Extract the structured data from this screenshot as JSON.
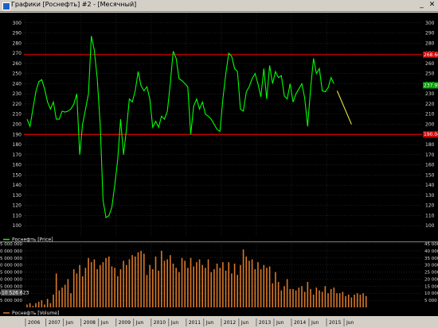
{
  "window": {
    "title": "Графики [Роснефть] #2 - [Месячный]",
    "minimize_glyph": "_",
    "close_glyph": "✕"
  },
  "colors": {
    "background": "#000000",
    "grid": "#3a3a3a",
    "price_line": "#00ff00",
    "projection_line": "#e8e040",
    "level_line": "#e00000",
    "level_badge": "#cc0000",
    "volume_bar": "#d87828",
    "current_price_badge": "#00a000"
  },
  "chart_data": [
    {
      "type": "line",
      "legend": "Роснефть [Price]",
      "ylim": [
        90,
        310
      ],
      "yticks": [
        100,
        110,
        120,
        130,
        140,
        150,
        160,
        170,
        180,
        190,
        200,
        210,
        220,
        230,
        240,
        250,
        260,
        270,
        280,
        290,
        300
      ],
      "grid": true,
      "levels": [
        {
          "value": 268.66,
          "label": "268.66"
        },
        {
          "value": 190.04,
          "label": "190.04"
        }
      ],
      "current_price_label": "237.95",
      "series": [
        {
          "values": [
            205,
            198,
            215,
            232,
            242,
            244,
            235,
            222,
            215,
            222,
            205,
            205,
            213,
            212,
            213,
            215,
            220,
            230,
            170,
            200,
            215,
            230,
            287,
            273,
            245,
            200,
            125,
            108,
            110,
            118,
            140,
            165,
            205,
            170,
            195,
            225,
            222,
            233,
            252,
            238,
            233,
            237,
            225,
            197,
            203,
            197,
            208,
            205,
            213,
            240,
            272,
            265,
            245,
            243,
            240,
            237,
            190,
            218,
            225,
            215,
            222,
            210,
            208,
            205,
            200,
            195,
            193,
            225,
            250,
            270,
            267,
            255,
            252,
            215,
            213,
            232,
            237,
            245,
            250,
            240,
            227,
            255,
            225,
            258,
            240,
            252,
            246,
            248,
            228,
            225,
            240,
            222,
            230,
            235,
            240,
            226,
            198,
            235,
            265,
            250,
            255,
            233,
            232,
            236,
            246,
            240
          ]
        },
        {
          "name": "projection",
          "values": [
            233,
            200
          ]
        }
      ]
    },
    {
      "type": "bar",
      "legend": "Роснефть [Volume]",
      "ylim": [
        0,
        45000000
      ],
      "yticks": [
        "5 000 000",
        "10 000 000",
        "15 000 000",
        "20 000 000",
        "25 000 000",
        "30 000 000",
        "35 000 000",
        "40 000 000",
        "45 000 000"
      ],
      "current_value_label": "10 526 623",
      "grid": true,
      "values": [
        2,
        3,
        1,
        3,
        4,
        5,
        2,
        6,
        3,
        9,
        24,
        12,
        14,
        16,
        20,
        10,
        27,
        24,
        30,
        22,
        28,
        35,
        32,
        34,
        27,
        30,
        32,
        35,
        36,
        29,
        28,
        22,
        27,
        33,
        30,
        34,
        37,
        36,
        39,
        40,
        38,
        23,
        30,
        27,
        36,
        26,
        40,
        33,
        34,
        37,
        31,
        28,
        25,
        35,
        33,
        28,
        35,
        29,
        32,
        34,
        30,
        28,
        34,
        25,
        27,
        31,
        28,
        32,
        26,
        32,
        24,
        31,
        23,
        30,
        41,
        36,
        33,
        34,
        27,
        32,
        27,
        30,
        28,
        29,
        17,
        25,
        18,
        12,
        15,
        20,
        13,
        13,
        12,
        14,
        15,
        11,
        18,
        13,
        9,
        14,
        12,
        11,
        15,
        10,
        13,
        14,
        10,
        10,
        11,
        8,
        9,
        7,
        9,
        10,
        9,
        10,
        8
      ]
    }
  ],
  "x_axis": {
    "labels": [
      "2006",
      "2007",
      "Jun",
      "2008",
      "Jun",
      "2009",
      "Jun",
      "2010",
      "Jun",
      "2011",
      "Jun",
      "2012",
      "Jun",
      "2013",
      "Jun",
      "2014",
      "Jun",
      "2015",
      "Jun"
    ]
  }
}
